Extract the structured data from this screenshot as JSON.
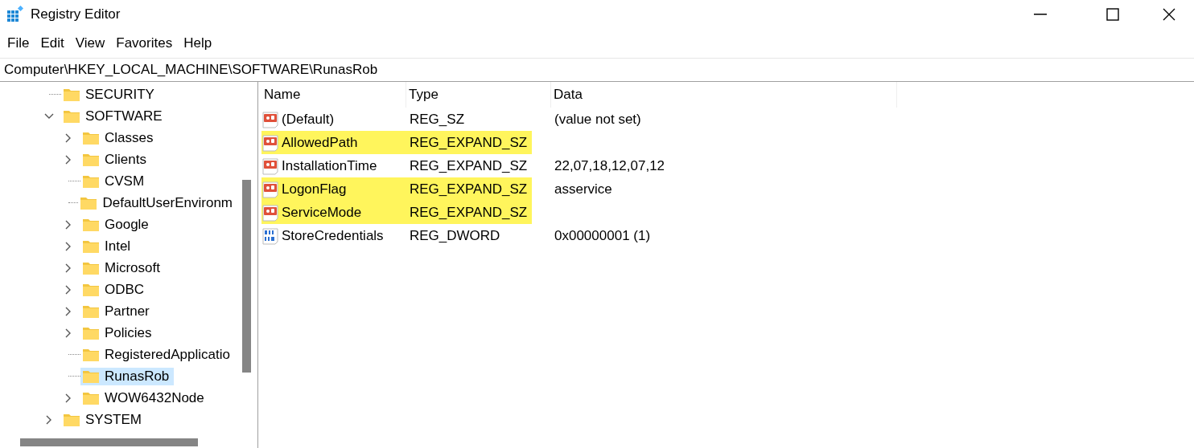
{
  "window": {
    "title": "Registry Editor"
  },
  "menu": [
    "File",
    "Edit",
    "View",
    "Favorites",
    "Help"
  ],
  "address": "Computer\\HKEY_LOCAL_MACHINE\\SOFTWARE\\RunasRob",
  "tree": [
    {
      "label": "SECURITY",
      "expandable": false,
      "selected": false
    },
    {
      "label": "SOFTWARE",
      "expandable": true,
      "expanded": true,
      "selected": false,
      "children": [
        {
          "label": "Classes",
          "expandable": true,
          "expanded": false,
          "selected": false
        },
        {
          "label": "Clients",
          "expandable": true,
          "expanded": false,
          "selected": false
        },
        {
          "label": "CVSM",
          "expandable": false,
          "selected": false
        },
        {
          "label": "DefaultUserEnvironm",
          "expandable": false,
          "selected": false
        },
        {
          "label": "Google",
          "expandable": true,
          "expanded": false,
          "selected": false
        },
        {
          "label": "Intel",
          "expandable": true,
          "expanded": false,
          "selected": false
        },
        {
          "label": "Microsoft",
          "expandable": true,
          "expanded": false,
          "selected": false
        },
        {
          "label": "ODBC",
          "expandable": true,
          "expanded": false,
          "selected": false
        },
        {
          "label": "Partner",
          "expandable": true,
          "expanded": false,
          "selected": false
        },
        {
          "label": "Policies",
          "expandable": true,
          "expanded": false,
          "selected": false
        },
        {
          "label": "RegisteredApplicatio",
          "expandable": false,
          "selected": false
        },
        {
          "label": "RunasRob",
          "expandable": false,
          "selected": true
        },
        {
          "label": "WOW6432Node",
          "expandable": true,
          "expanded": false,
          "selected": false
        }
      ]
    },
    {
      "label": "SYSTEM",
      "expandable": true,
      "expanded": false,
      "selected": false
    }
  ],
  "table": {
    "columns": [
      "Name",
      "Type",
      "Data"
    ],
    "rows": [
      {
        "kind": "string",
        "name": "(Default)",
        "type": "REG_SZ",
        "data": "(value not set)",
        "highlighted": false
      },
      {
        "kind": "string",
        "name": "AllowedPath",
        "type": "REG_EXPAND_SZ",
        "highlighted": true
      },
      {
        "kind": "string",
        "name": "InstallationTime",
        "type": "REG_EXPAND_SZ",
        "data": "22,07,18,12,07,12",
        "highlighted": false
      },
      {
        "kind": "string",
        "name": "LogonFlag",
        "type": "REG_EXPAND_SZ",
        "data": "asservice",
        "highlighted": true
      },
      {
        "kind": "string",
        "name": "ServiceMode",
        "type": "REG_EXPAND_SZ",
        "highlighted": true
      },
      {
        "kind": "binary",
        "name": "StoreCredentials",
        "type": "REG_DWORD",
        "data": "0x00000001 (1)",
        "highlighted": false
      }
    ]
  }
}
